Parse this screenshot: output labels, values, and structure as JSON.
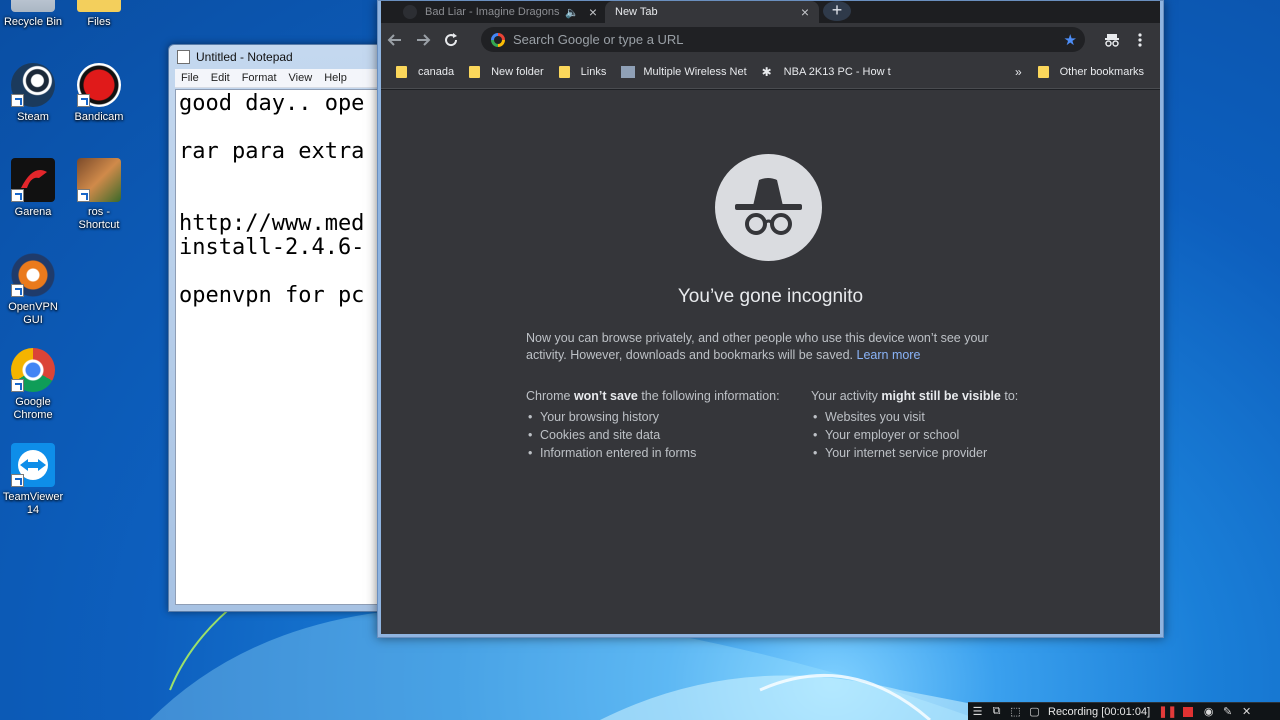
{
  "desktop": {
    "icons": [
      {
        "label": "Recycle Bin"
      },
      {
        "label": "Files"
      },
      {
        "label": "Steam"
      },
      {
        "label": "Bandicam"
      },
      {
        "label": "Garena"
      },
      {
        "label": "ros - Shortcut"
      },
      {
        "label": "OpenVPN GUI"
      },
      {
        "label": "Google Chrome"
      },
      {
        "label": "TeamViewer 14"
      }
    ]
  },
  "notepad": {
    "title": "Untitled - Notepad",
    "menu": [
      "File",
      "Edit",
      "Format",
      "View",
      "Help"
    ],
    "text": "good day.. ope\n\nrar para extra\n\n\nhttp://www.med\ninstall-2.4.6-\n\nopenvpn for pc"
  },
  "chrome": {
    "tabs": [
      {
        "title": "Bad Liar - Imagine Dragons",
        "close": "×",
        "audio": "🔈"
      },
      {
        "title": "New Tab",
        "close": "×"
      }
    ],
    "new_tab": "+",
    "omnibox_placeholder": "Search Google or type a URL",
    "bookmarks": [
      {
        "label": "canada"
      },
      {
        "label": "New folder"
      },
      {
        "label": "Links"
      },
      {
        "label": "Multiple Wireless Net"
      },
      {
        "label": "NBA 2K13 PC - How t"
      }
    ],
    "other_bookmarks": "Other bookmarks",
    "incognito": {
      "title": "You’ve gone incognito",
      "intro": "Now you can browse privately, and other people who use this device won’t see your activity. However, downloads and bookmarks will be saved.",
      "learn_more": "Learn more",
      "left_prefix": "Chrome ",
      "left_bold": "won’t save",
      "left_suffix": " the following information:",
      "left_items": [
        "Your browsing history",
        "Cookies and site data",
        "Information entered in forms"
      ],
      "right_prefix": "Your activity ",
      "right_bold": "might still be visible",
      "right_suffix": " to:",
      "right_items": [
        "Websites you visit",
        "Your employer or school",
        "Your internet service provider"
      ]
    }
  },
  "recorder": {
    "status": "Recording [00:01:04]"
  }
}
